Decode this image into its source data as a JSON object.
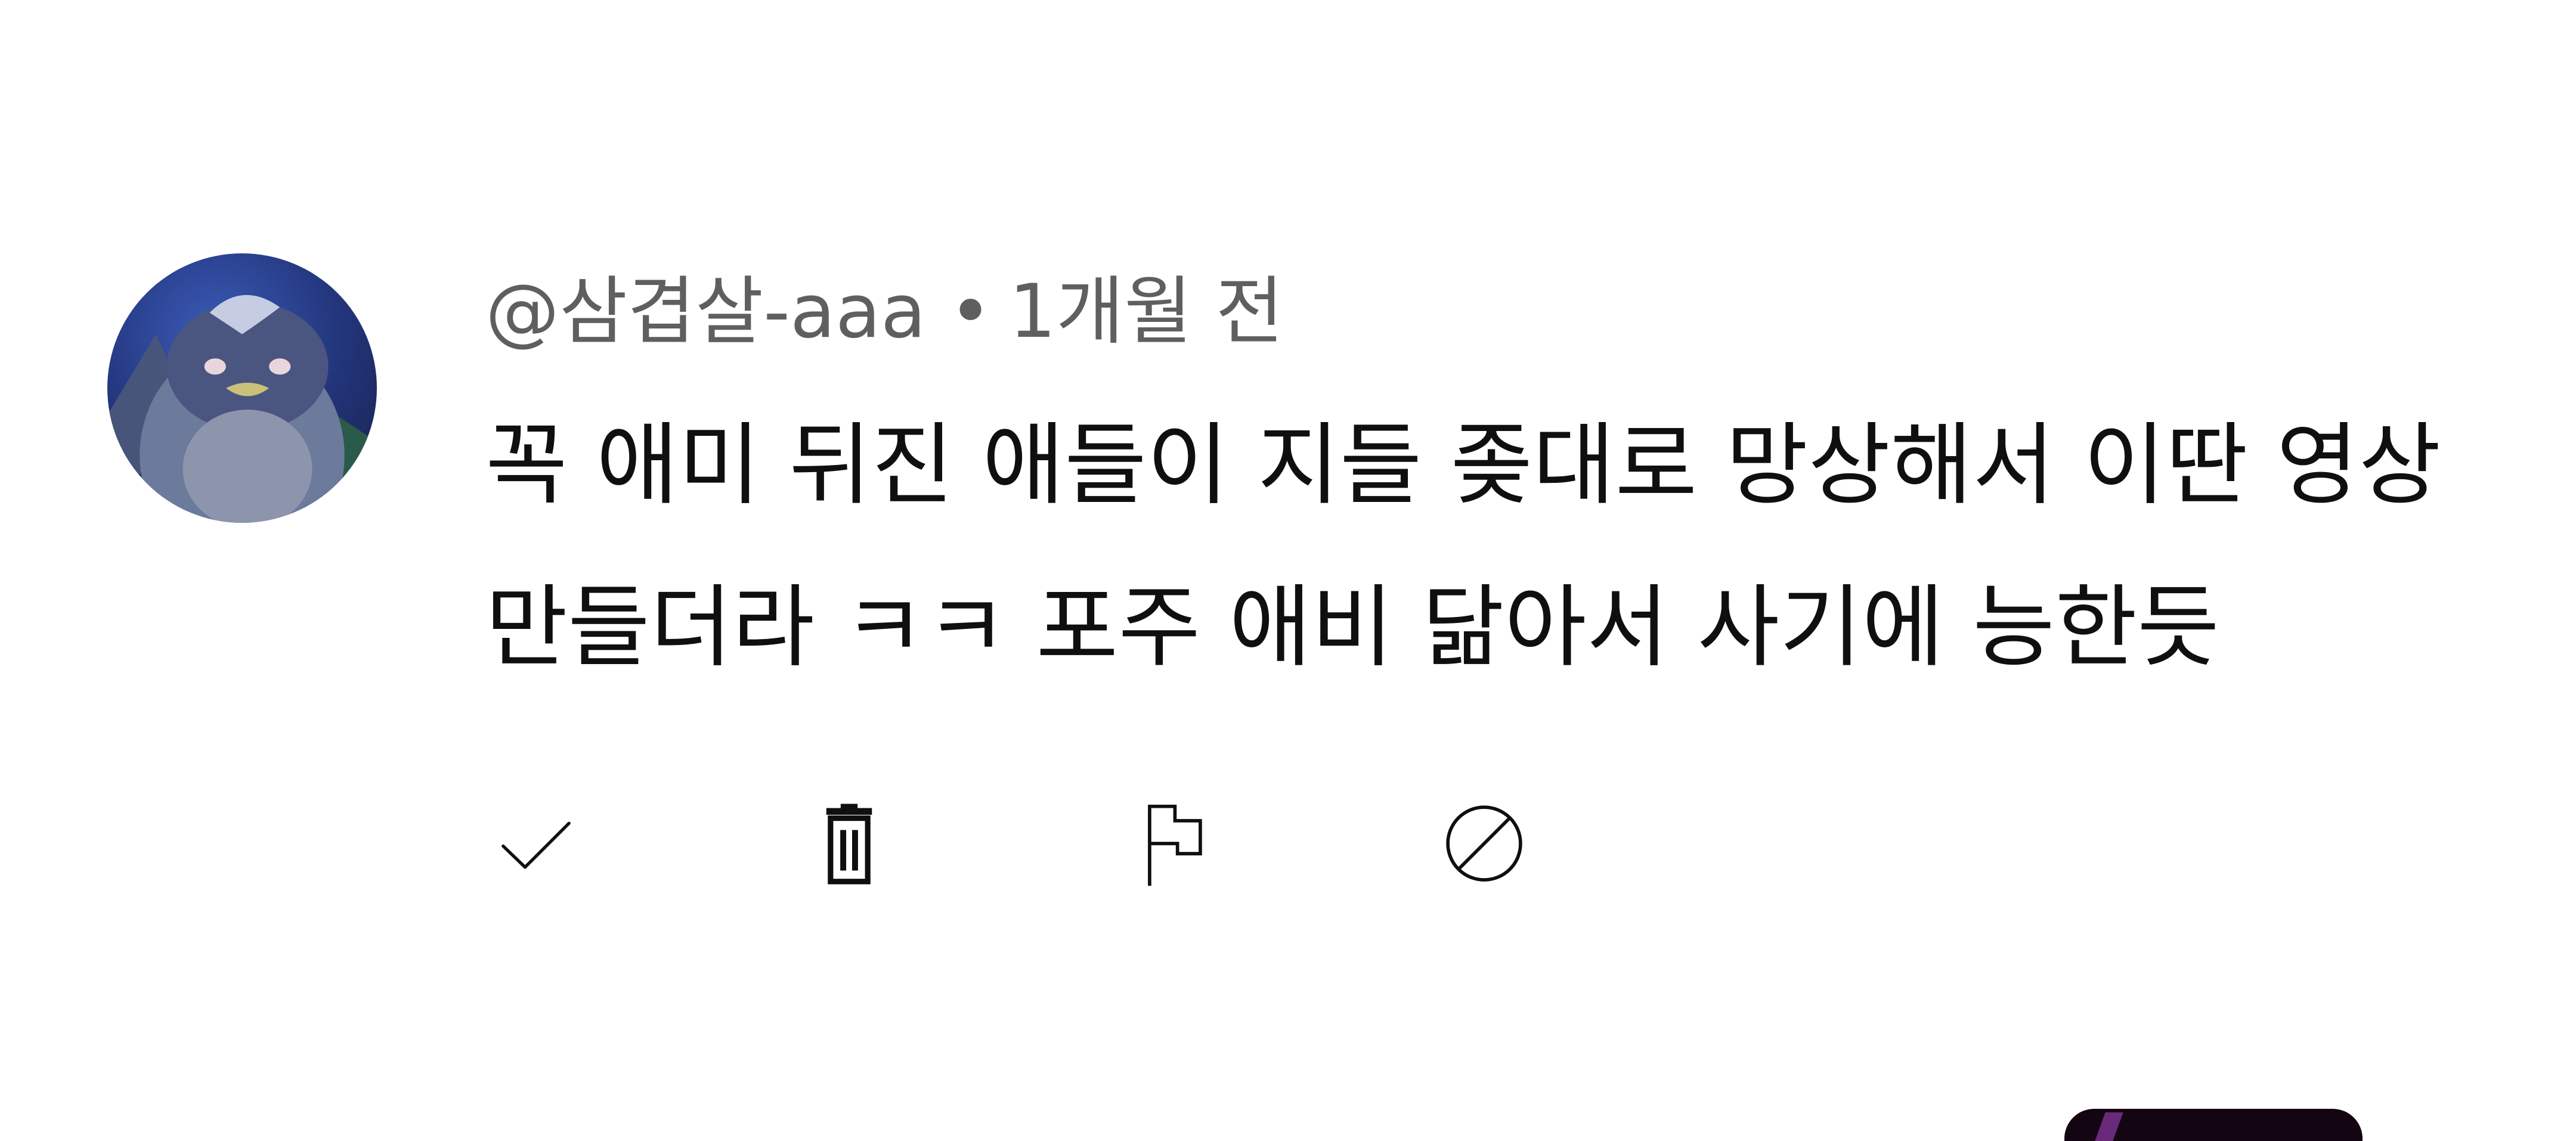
{
  "comment": {
    "author_handle": "@삼겹살-aaa",
    "separator": "•",
    "timestamp": "1개월 전",
    "text_lines": [
      "꼭 애미 뒤진 애들이 지들 좆대로 망상해서 이딴 영상",
      "만들더라 ㅋㅋ 포주 애비 닮아서 사기에 능한듯"
    ]
  },
  "actions": [
    {
      "name": "approve",
      "icon": "checkmark-icon"
    },
    {
      "name": "delete",
      "icon": "trash-icon"
    },
    {
      "name": "report",
      "icon": "flag-icon"
    },
    {
      "name": "block",
      "icon": "block-icon"
    }
  ],
  "colors": {
    "background": "#ffffff",
    "meta_text": "#5f5f5f",
    "body_text": "#0f0f0f",
    "icon": "#0f0f0f"
  }
}
